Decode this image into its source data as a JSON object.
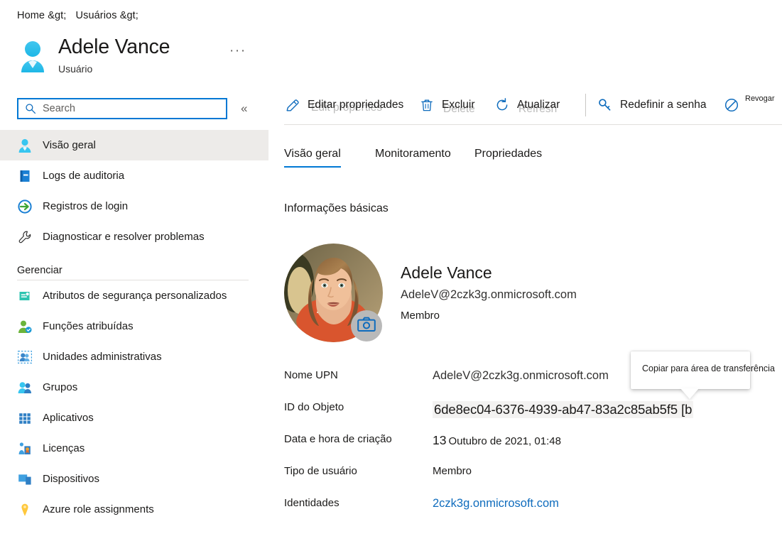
{
  "breadcrumb": {
    "items": [
      "Home &gt;",
      "Usuários &gt;"
    ]
  },
  "header": {
    "title": "Adele Vance",
    "subtitle": "Usuário",
    "more_label": "···",
    "avatar_icon": "user-avatar-icon"
  },
  "search": {
    "placeholder": "Search",
    "value": "",
    "icon": "search-icon",
    "collapse_label": "«"
  },
  "sidebar": {
    "items": [
      {
        "label": "Visão geral",
        "icon": "user-icon",
        "selected": true
      },
      {
        "label": "Logs de auditoria",
        "icon": "audit-log-icon",
        "selected": false
      },
      {
        "label": "Registros de login",
        "icon": "sign-in-icon",
        "selected": false
      },
      {
        "label": "Diagnosticar e resolver problemas",
        "icon": "wrench-icon",
        "selected": false
      }
    ],
    "group_label": "Gerenciar",
    "manage_items": [
      {
        "label": "Atributos de segurança personalizados",
        "icon": "custom-security-attributes-icon"
      },
      {
        "label": "Funções atribuídas",
        "icon": "assigned-roles-icon"
      },
      {
        "label": "Unidades administrativas",
        "icon": "administrative-units-icon"
      },
      {
        "label": "Grupos",
        "icon": "groups-icon"
      },
      {
        "label": "Aplicativos",
        "icon": "applications-icon"
      },
      {
        "label": "Licenças",
        "icon": "licenses-icon"
      },
      {
        "label": "Dispositivos",
        "icon": "devices-icon"
      },
      {
        "label": "Azure role assignments",
        "icon": "key-icon"
      }
    ]
  },
  "toolbar": {
    "commands": [
      {
        "label": "Editar propriedades",
        "ghost": "Edit properties",
        "icon": "pencil-icon"
      },
      {
        "label": "Excluir",
        "ghost": "Delete",
        "icon": "trash-icon"
      },
      {
        "label": "Atualizar",
        "ghost": "Refresh",
        "icon": "refresh-icon"
      },
      {
        "label": "Redefinir a senha",
        "ghost": "",
        "icon": "key-reset-icon"
      },
      {
        "label": "Revogar",
        "ghost": "",
        "icon": "revoke-icon"
      }
    ]
  },
  "tabs": [
    {
      "label": "Visão geral",
      "active": true
    },
    {
      "label": "Monitoramento",
      "active": false
    },
    {
      "label": "Propriedades",
      "active": false
    }
  ],
  "content": {
    "section_title": "Informações básicas",
    "identity": {
      "name": "Adele Vance",
      "upn": "AdeleV@2czk3g.onmicrosoft.com",
      "user_type": "Membro",
      "photo_alt": "profile-photo",
      "camera_icon": "camera-icon"
    },
    "properties": [
      {
        "key": "Nome UPN",
        "value": "AdeleV@2czk3g.onmicrosoft.com",
        "style": "seg"
      },
      {
        "key": "ID do Objeto",
        "value": "6de8ec04-6376-4939-ab47-83a2c85ab5f5 [b",
        "style": "mono-hl"
      },
      {
        "key": "Data e hora de criação",
        "value": "13 Outubro de 2021, 01:48",
        "style": "date",
        "date_num": "13",
        "date_rest": "Outubro de 2021, 01:48"
      },
      {
        "key": "Tipo de usuário",
        "value": "Membro",
        "style": "small"
      },
      {
        "key": "Identidades",
        "value": "2czk3g.onmicrosoft.com",
        "style": "link"
      }
    ]
  },
  "tooltip": {
    "text": "Copiar para área de transferência"
  },
  "colors": {
    "accent": "#0078d4",
    "link": "#0f6cbd",
    "selected_bg": "#edebe9",
    "highlight_bg": "#f3f2f1",
    "divider": "#e1dfdd",
    "text": "#1b1a19"
  }
}
